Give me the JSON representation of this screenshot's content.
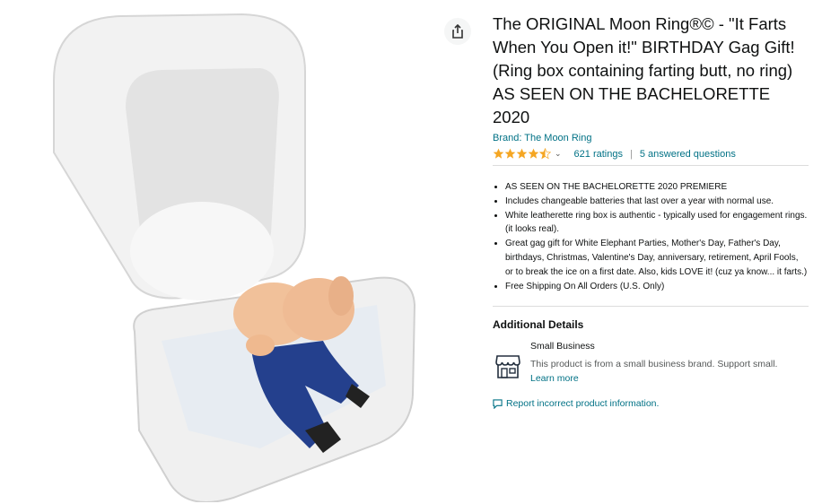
{
  "product": {
    "title": "The ORIGINAL Moon Ring®© - \"It Farts When You Open it!\" BIRTHDAY Gag Gift! (Ring box containing farting butt, no ring) AS SEEN ON THE BACHELORETTE 2020",
    "brand_link": "Brand: The Moon Ring",
    "rating_value": 4.5,
    "ratings_label": "621 ratings",
    "separator": "|",
    "answered_label": "5 answered questions"
  },
  "bullets": [
    "AS SEEN ON THE BACHELORETTE 2020 PREMIERE",
    "Includes changeable batteries that last over a year with normal use.",
    "White leatherette ring box is authentic - typically used for engagement rings. (it looks real).",
    "Great gag gift for White Elephant Parties, Mother's Day, Father's Day, birthdays, Christmas, Valentine's Day, anniversary, retirement, April Fools, or to break the ice on a first date. Also, kids LOVE it! (cuz ya know... it farts.)",
    "Free Shipping On All Orders (U.S. Only)"
  ],
  "additional": {
    "heading": "Additional Details",
    "small_business_title": "Small Business",
    "small_business_desc": "This product is from a small business brand. Support small.",
    "learn_more": "Learn more"
  },
  "report_link": "Report incorrect product information.",
  "icons": {
    "share": "share-icon",
    "star": "star-icon",
    "chevron": "chevron-down-icon",
    "store": "storefront-icon",
    "report": "comment-icon"
  },
  "colors": {
    "link": "#007185",
    "star": "#f5a623",
    "text": "#0f1111",
    "muted": "#565959"
  }
}
